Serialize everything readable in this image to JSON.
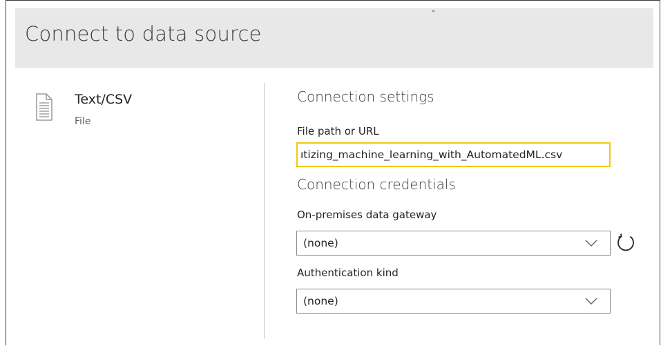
{
  "header": {
    "title": "Connect to data source"
  },
  "source": {
    "name": "Text/CSV",
    "type": "File",
    "icon": "document-icon"
  },
  "connection_settings": {
    "title": "Connection settings",
    "file_path_label": "File path or URL",
    "file_path_value": "ıtizing_machine_learning_with_AutomatedML.csv"
  },
  "connection_credentials": {
    "title": "Connection credentials",
    "gateway_label": "On-premises data gateway",
    "gateway_value": "(none)",
    "auth_label": "Authentication kind",
    "auth_value": "(none)"
  },
  "colors": {
    "header_bg": "#e8e8e8",
    "input_focus_border": "#f2c811",
    "divider": "#c8c6c4"
  },
  "icons": [
    "document-icon",
    "chevron-down-icon",
    "refresh-icon"
  ]
}
